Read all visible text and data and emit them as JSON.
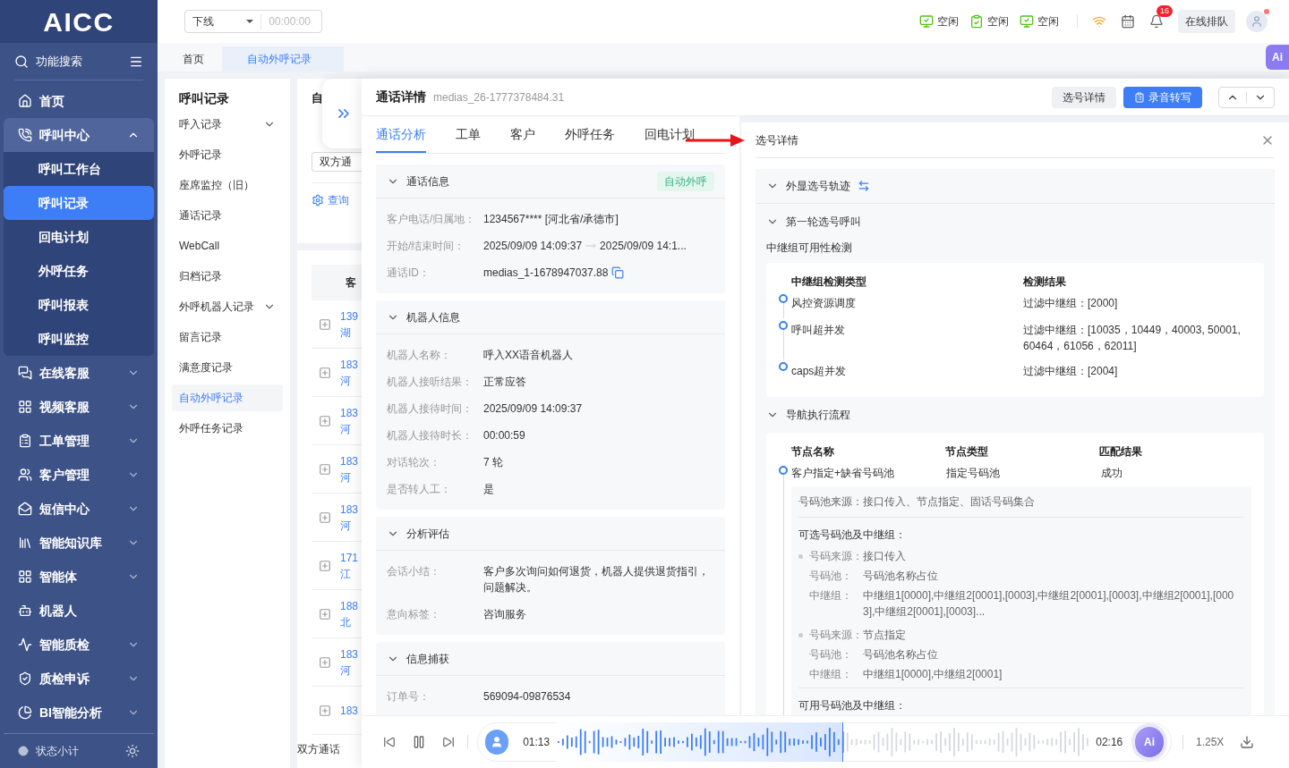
{
  "sidebar": {
    "logo": "AICC",
    "search": "功能搜索",
    "items": [
      {
        "label": "首页",
        "kind": "link",
        "selected": false
      },
      {
        "label": "呼叫中心",
        "kind": "group",
        "expanded": true,
        "selected": false,
        "children": [
          {
            "label": "呼叫工作台",
            "selected": false
          },
          {
            "label": "呼叫记录",
            "selected": true
          },
          {
            "label": "回电计划",
            "selected": false
          },
          {
            "label": "外呼任务",
            "selected": false
          },
          {
            "label": "呼叫报表",
            "selected": false
          },
          {
            "label": "呼叫监控",
            "selected": false
          }
        ]
      },
      {
        "label": "在线客服",
        "kind": "group",
        "expanded": false,
        "selected": false
      },
      {
        "label": "视频客服",
        "kind": "group",
        "expanded": false,
        "selected": false
      },
      {
        "label": "工单管理",
        "kind": "group",
        "expanded": false,
        "selected": false
      },
      {
        "label": "客户管理",
        "kind": "group",
        "expanded": false,
        "selected": false
      },
      {
        "label": "短信中心",
        "kind": "group",
        "expanded": false,
        "selected": false
      },
      {
        "label": "智能知识库",
        "kind": "group",
        "expanded": false,
        "selected": false
      },
      {
        "label": "智能体",
        "kind": "group",
        "expanded": false,
        "selected": false
      },
      {
        "label": "机器人",
        "kind": "link",
        "selected": false
      },
      {
        "label": "智能质检",
        "kind": "group",
        "expanded": false,
        "selected": false
      },
      {
        "label": "质检申诉",
        "kind": "group",
        "expanded": false,
        "selected": false
      },
      {
        "label": "BI智能分析",
        "kind": "group",
        "expanded": false,
        "selected": false
      }
    ],
    "footer": "状态小计"
  },
  "topbar": {
    "status": "下线",
    "timer": "00:00:00",
    "agents": [
      {
        "label": "空闲"
      },
      {
        "label": "空闲"
      },
      {
        "label": "空闲"
      }
    ],
    "notification_count": "16",
    "queue_button": "在线排队",
    "ai_button": "Ai"
  },
  "tabs": [
    {
      "label": "首页",
      "selected": false
    },
    {
      "label": "自动外呼记录",
      "selected": true
    }
  ],
  "submenu": {
    "title": "呼叫记录",
    "items": [
      {
        "label": "呼入记录",
        "kind": "group",
        "expanded": false,
        "selected": false
      },
      {
        "label": "外呼记录",
        "kind": "link",
        "selected": false
      },
      {
        "label": "座席监控（旧）",
        "kind": "link",
        "selected": false
      },
      {
        "label": "通话记录",
        "kind": "link",
        "selected": false
      },
      {
        "label": "WebCall",
        "kind": "link",
        "selected": false
      },
      {
        "label": "归档记录",
        "kind": "link",
        "selected": false
      },
      {
        "label": "外呼机器人记录",
        "kind": "group",
        "expanded": false,
        "selected": false
      },
      {
        "label": "留言记录",
        "kind": "link",
        "selected": false
      },
      {
        "label": "满意度记录",
        "kind": "link",
        "selected": false
      },
      {
        "label": "自动外呼记录",
        "kind": "link",
        "selected": true
      },
      {
        "label": "外呼任务记录",
        "kind": "link",
        "selected": false
      }
    ]
  },
  "list_panel": {
    "title": "自",
    "filter": "双方通",
    "query": "查询",
    "column_1": "客",
    "rows": [
      {
        "line_1": "139",
        "line_2": "湖"
      },
      {
        "line_1": "183",
        "line_2": "河"
      },
      {
        "line_1": "183",
        "line_2": "河"
      },
      {
        "line_1": "183",
        "line_2": "河"
      },
      {
        "line_1": "183",
        "line_2": "河"
      },
      {
        "line_1": "171",
        "line_2": "江"
      },
      {
        "line_1": "188",
        "line_2": "北"
      },
      {
        "line_1": "183",
        "line_2": "河"
      },
      {
        "line_1": "183"
      }
    ],
    "footer": "双方通话"
  },
  "drawer": {
    "title": "通话详情",
    "call_id": "medias_26-1777378484.31",
    "buttons": [
      {
        "label": "选号详情",
        "kind": "default"
      },
      {
        "label": "录音转写",
        "kind": "primary"
      }
    ],
    "detail_tabs": [
      {
        "label": "通话分析",
        "selected": true
      },
      {
        "label": "工单",
        "selected": false
      },
      {
        "label": "客户",
        "selected": false
      },
      {
        "label": "外呼任务",
        "selected": false
      },
      {
        "label": "回电计划",
        "selected": false
      }
    ],
    "sections": [
      {
        "title": "通话信息",
        "tag": "自动外呼",
        "expanded": true,
        "fields": [
          {
            "label": "客户电话/归属地：",
            "value": "1234567**** [河北省/承德市]",
            "kind": "text"
          },
          {
            "label": "开始/结束时间：",
            "value": "2025/09/09 14:09:37",
            "value_end": "2025/09/09 14:1...",
            "kind": "range"
          },
          {
            "label": "通话ID：",
            "value": "medias_1-1678947037.88",
            "kind": "copy"
          }
        ]
      },
      {
        "title": "机器人信息",
        "expanded": true,
        "fields": [
          {
            "label": "机器人名称：",
            "value": "呼入XX语音机器人",
            "kind": "text"
          },
          {
            "label": "机器人接听结果：",
            "value": "正常应答",
            "kind": "text"
          },
          {
            "label": "机器人接待时间：",
            "value": "2025/09/09 14:09:37",
            "kind": "text"
          },
          {
            "label": "机器人接待时长：",
            "value": "00:00:59",
            "kind": "text"
          },
          {
            "label": "对话轮次：",
            "value": "7 轮",
            "kind": "text"
          },
          {
            "label": "是否转人工：",
            "value": "是",
            "kind": "text"
          }
        ]
      },
      {
        "title": "分析评估",
        "expanded": true,
        "fields": [
          {
            "label": "会话小结：",
            "value": "客户多次询问如何退货，机器人提供退货指引，问题解决。",
            "kind": "text"
          },
          {
            "label": "意向标签：",
            "value": "咨询服务",
            "kind": "text"
          }
        ]
      },
      {
        "title": "信息捕获",
        "expanded": true,
        "fields": [
          {
            "label": "订单号：",
            "value": "569094-09876534",
            "kind": "text"
          }
        ]
      }
    ],
    "selection": {
      "title": "选号详情",
      "track": {
        "title": "外显选号轨迹",
        "expanded": true
      },
      "round": {
        "title": "第一轮选号呼叫",
        "expanded": true
      },
      "check": {
        "title": "中继组可用性检测",
        "columns": [
          "中继组检测类型",
          "检测结果"
        ],
        "rows": [
          {
            "type": "风控资源调度",
            "result": "过滤中继组：[2000]"
          },
          {
            "type": "呼叫超并发",
            "result": "过滤中继组：[10035，10449，40003, 50001, 60464，61056，62011]"
          },
          {
            "type": "caps超并发",
            "result": "过滤中继组：[2004]"
          }
        ]
      },
      "navigation": {
        "title": "导航执行流程",
        "expanded": true,
        "columns": [
          "节点名称",
          "节点类型",
          "匹配结果"
        ],
        "rows": [
          {
            "name": "客户指定+缺省号码池",
            "type": "指定号码池",
            "result": "成功"
          }
        ],
        "pool_source_label": "号码池来源：",
        "pool_source": "接口传入、节点指定、固话号码集合",
        "optional_title": "可选号码池及中继组：",
        "sources": [
          {
            "source_label": "号码来源：",
            "source": "接口传入",
            "pool_label": "号码池：",
            "pool": "号码池名称占位",
            "trunk_label": "中继组：",
            "trunk": "中继组1[0000],中继组2[0001],[0003],中继组2[0001],[0003],中继组2[0001],[0003],中继组2[0001],[0003]..."
          },
          {
            "source_label": "号码来源：",
            "source": "节点指定",
            "pool_label": "号码池：",
            "pool": "号码池名称占位",
            "trunk_label": "中继组：",
            "trunk": "中继组1[0000],中继组2[0001]"
          }
        ],
        "available_title": "可用号码池及中继组："
      }
    },
    "player": {
      "current": "01:13",
      "total": "02:16",
      "level": 0.537,
      "ai_label": "Ai",
      "speed": "1.25X"
    }
  }
}
